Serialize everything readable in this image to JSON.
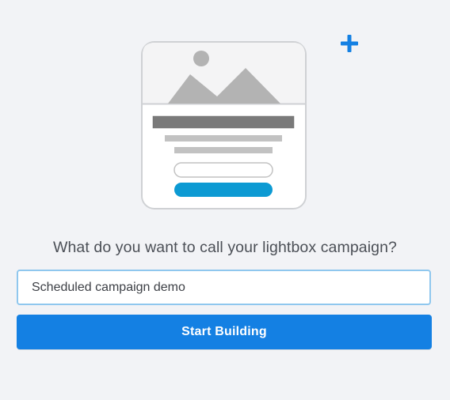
{
  "illustration": {
    "icon": "lightbox-preview-illustration",
    "accent_color": "#0c9ad3"
  },
  "add_icon": {
    "icon": "plus-icon",
    "color": "#1480e3"
  },
  "prompt": {
    "question": "What do you want to call your lightbox campaign?"
  },
  "campaign_name_input": {
    "value": "Scheduled campaign demo",
    "border_color": "#8fc7ee"
  },
  "primary_action": {
    "label": "Start Building",
    "color": "#1480e3"
  }
}
